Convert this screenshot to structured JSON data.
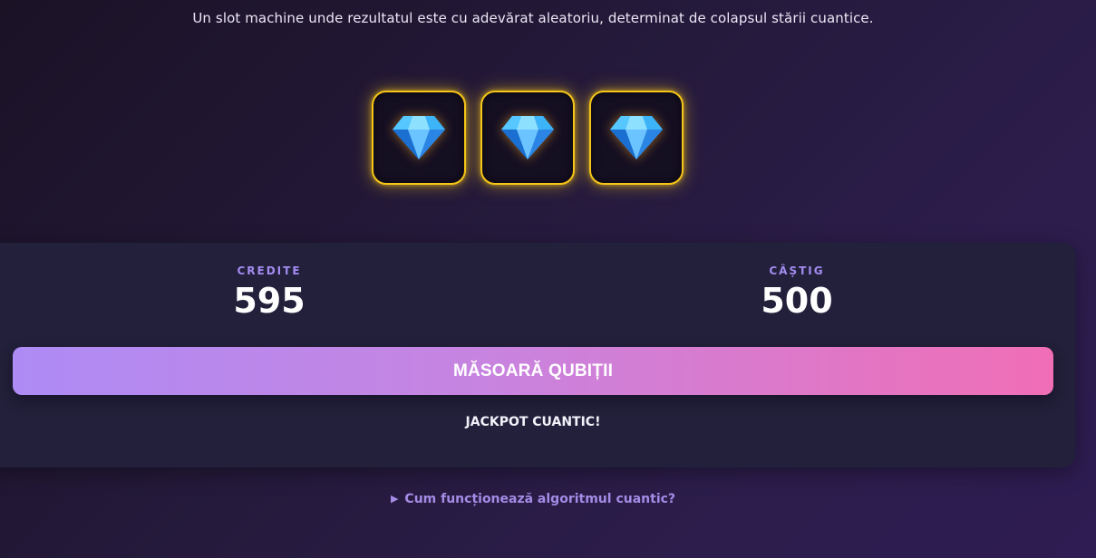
{
  "header": {
    "subtitle": "Un slot machine unde rezultatul este cu adevărat aleatoriu, determinat de colapsul stării cuantice."
  },
  "reels": [
    {
      "symbol": "diamond-icon"
    },
    {
      "symbol": "diamond-icon"
    },
    {
      "symbol": "diamond-icon"
    }
  ],
  "stats": {
    "credits_label": "CREDITE",
    "credits_value": "595",
    "win_label": "CÂȘTIG",
    "win_value": "500"
  },
  "spin_button": {
    "label": "MĂSOARĂ QUBIȚII"
  },
  "result": {
    "message": "JACKPOT CUANTIC!"
  },
  "details": {
    "summary": "Cum funcționează algoritmul cuantic?"
  },
  "colors": {
    "accent": "#a58cf2",
    "reel_border": "#f5c518",
    "button_gradient_start": "#ae8bf5",
    "button_gradient_end": "#f06eb6"
  }
}
